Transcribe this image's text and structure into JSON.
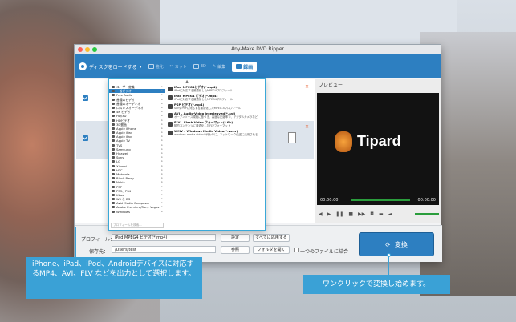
{
  "window": {
    "title": "Any-Make DVD Ripper"
  },
  "toolbar": {
    "load_label": "ディスクをロードする",
    "items": [
      {
        "label": "強化",
        "icon": "enhance-icon"
      },
      {
        "label": "カット",
        "icon": "scissors-icon"
      },
      {
        "label": "3D",
        "icon": "3d-icon"
      },
      {
        "label": "編集",
        "icon": "edit-icon"
      }
    ],
    "active_label": "録画"
  },
  "dropdown": {
    "categories": [
      "ユーザー定義",
      "一般ビデオ",
      "Free Audio",
      "普通のビデオ",
      "普通のオーディオ",
      "ロスレスオーディオ",
      "4K ビデオ",
      "HD/3D",
      "HDビデオ",
      "3D動画",
      "Apple iPhone",
      "Apple iPad",
      "Apple iPod",
      "Apple TV",
      "TVS",
      "Samsung",
      "Huawei",
      "Sony",
      "LG",
      "Xiaomi",
      "HTC",
      "Motorola",
      "Black Berry",
      "Nokia",
      "PSP",
      "PS3、PS4",
      "Xbox",
      "Wii と DS",
      "Avid Media Composer",
      "Adobe Premiere/Sony Vegas",
      "Windows"
    ],
    "selected_category": "一般ビデオ",
    "formats": [
      {
        "name": "iPad MPEG4ビデオ(*.mp4)",
        "desc": "iPadに対応する最適化したMPEG4プロフィール"
      },
      {
        "name": "iPad MPEG4 ビデオ(*.mp4)",
        "desc": "iPadに対応する最適化したMPEG4プロフィール"
      },
      {
        "name": "PSP ビデオ(*.mp4)",
        "desc": "Sony PSPに対応する最適化したMPEG-4プロフィール"
      },
      {
        "name": "AVI – Audio-Video Interleaved(*.avi)",
        "desc": "オープンソース規格に基づき、高度な圧縮率で、デジタルカメラなど"
      },
      {
        "name": "FLV – Flash Video フォーマット(*.flv)",
        "desc": "動的コンテンツに最適化したFLVフォーマット"
      },
      {
        "name": "WMV – Windows Media Video(*.wmv)",
        "desc": "windows media videoの代わりに、ネットワーク伝送に活用される"
      }
    ],
    "search_placeholder": "プロフィールを検索..."
  },
  "preview": {
    "label": "プレビュー",
    "brand": "Tipard",
    "time_start": "00:00:00",
    "time_end": "00:00:00"
  },
  "bottom": {
    "profile_label": "プロフィール：",
    "profile_value": "iPad MPEG4 ビデオ(*.mp4)",
    "settings_button": "設定",
    "apply_all_button": "すべてに応用する",
    "save_label": "保存先：",
    "save_value": "/Users/test",
    "browse_button": "参照",
    "open_folder_button": "フォルダを開く",
    "merge_label": "一つのファイルに結合",
    "convert_button": "変換"
  },
  "callouts": {
    "left": "iPhone、iPad、iPod、Androidデバイスに対応するMP4、AVI、FLV などを出力として選択します。",
    "right": "ワンクリックで変換し始めます。"
  },
  "colors": {
    "accent": "#2d7fc1",
    "callout": "#3aa1d6",
    "convert": "#2d7fc1"
  }
}
